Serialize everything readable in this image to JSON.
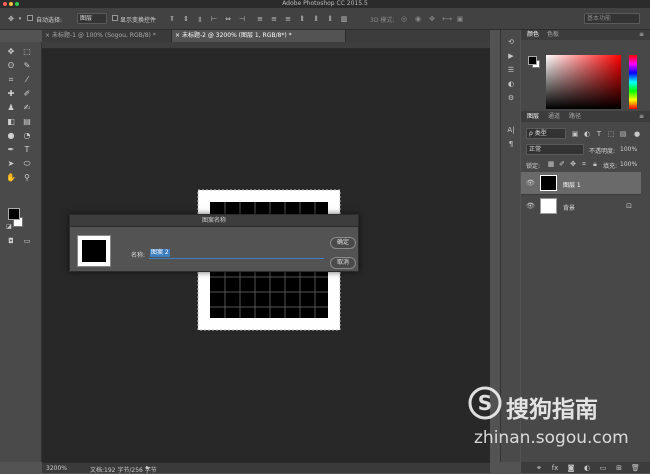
{
  "app": {
    "title": "Adobe Photoshop CC 2015.5",
    "workspace_placeholder": "基本功能"
  },
  "options_bar": {
    "auto_select_label": "自动选择:",
    "auto_select_value": "图层",
    "show_transform_label": "显示变换控件",
    "mode_3d_label": "3D 模式:"
  },
  "tabs": [
    {
      "label": "未标题-1 @ 100% (Sogou, RGB/8) *"
    },
    {
      "label": "未标题-2 @ 3200% (图层 1, RGB/8*) *"
    }
  ],
  "status": {
    "zoom": "3200%",
    "doc_info": "文档:192 字节/256 字节"
  },
  "right_panel": {
    "color_tab": "颜色",
    "swatches_tab": "色板",
    "layers_tab": "图层",
    "channels_tab": "通道",
    "paths_tab": "路径",
    "filter_kind": "ρ 类型",
    "blend_mode": "正常",
    "opacity_label": "不透明度:",
    "opacity_value": "100%",
    "lock_label": "锁定:",
    "fill_label": "填充:",
    "fill_value": "100%",
    "layers": [
      {
        "name": "图层 1",
        "selected": true
      },
      {
        "name": "背景",
        "locked": true
      }
    ]
  },
  "dialog": {
    "title": "图案名称",
    "name_label": "名称:",
    "name_value": "图案 2",
    "ok_label": "确定",
    "cancel_label": "取消"
  },
  "watermark": {
    "brand": "搜狗指南",
    "url": "zhinan.sogou.com"
  },
  "colors": {
    "accent_selection": "#3d7ebf",
    "canvas_bg": "#282828",
    "panel_bg": "#484848"
  }
}
